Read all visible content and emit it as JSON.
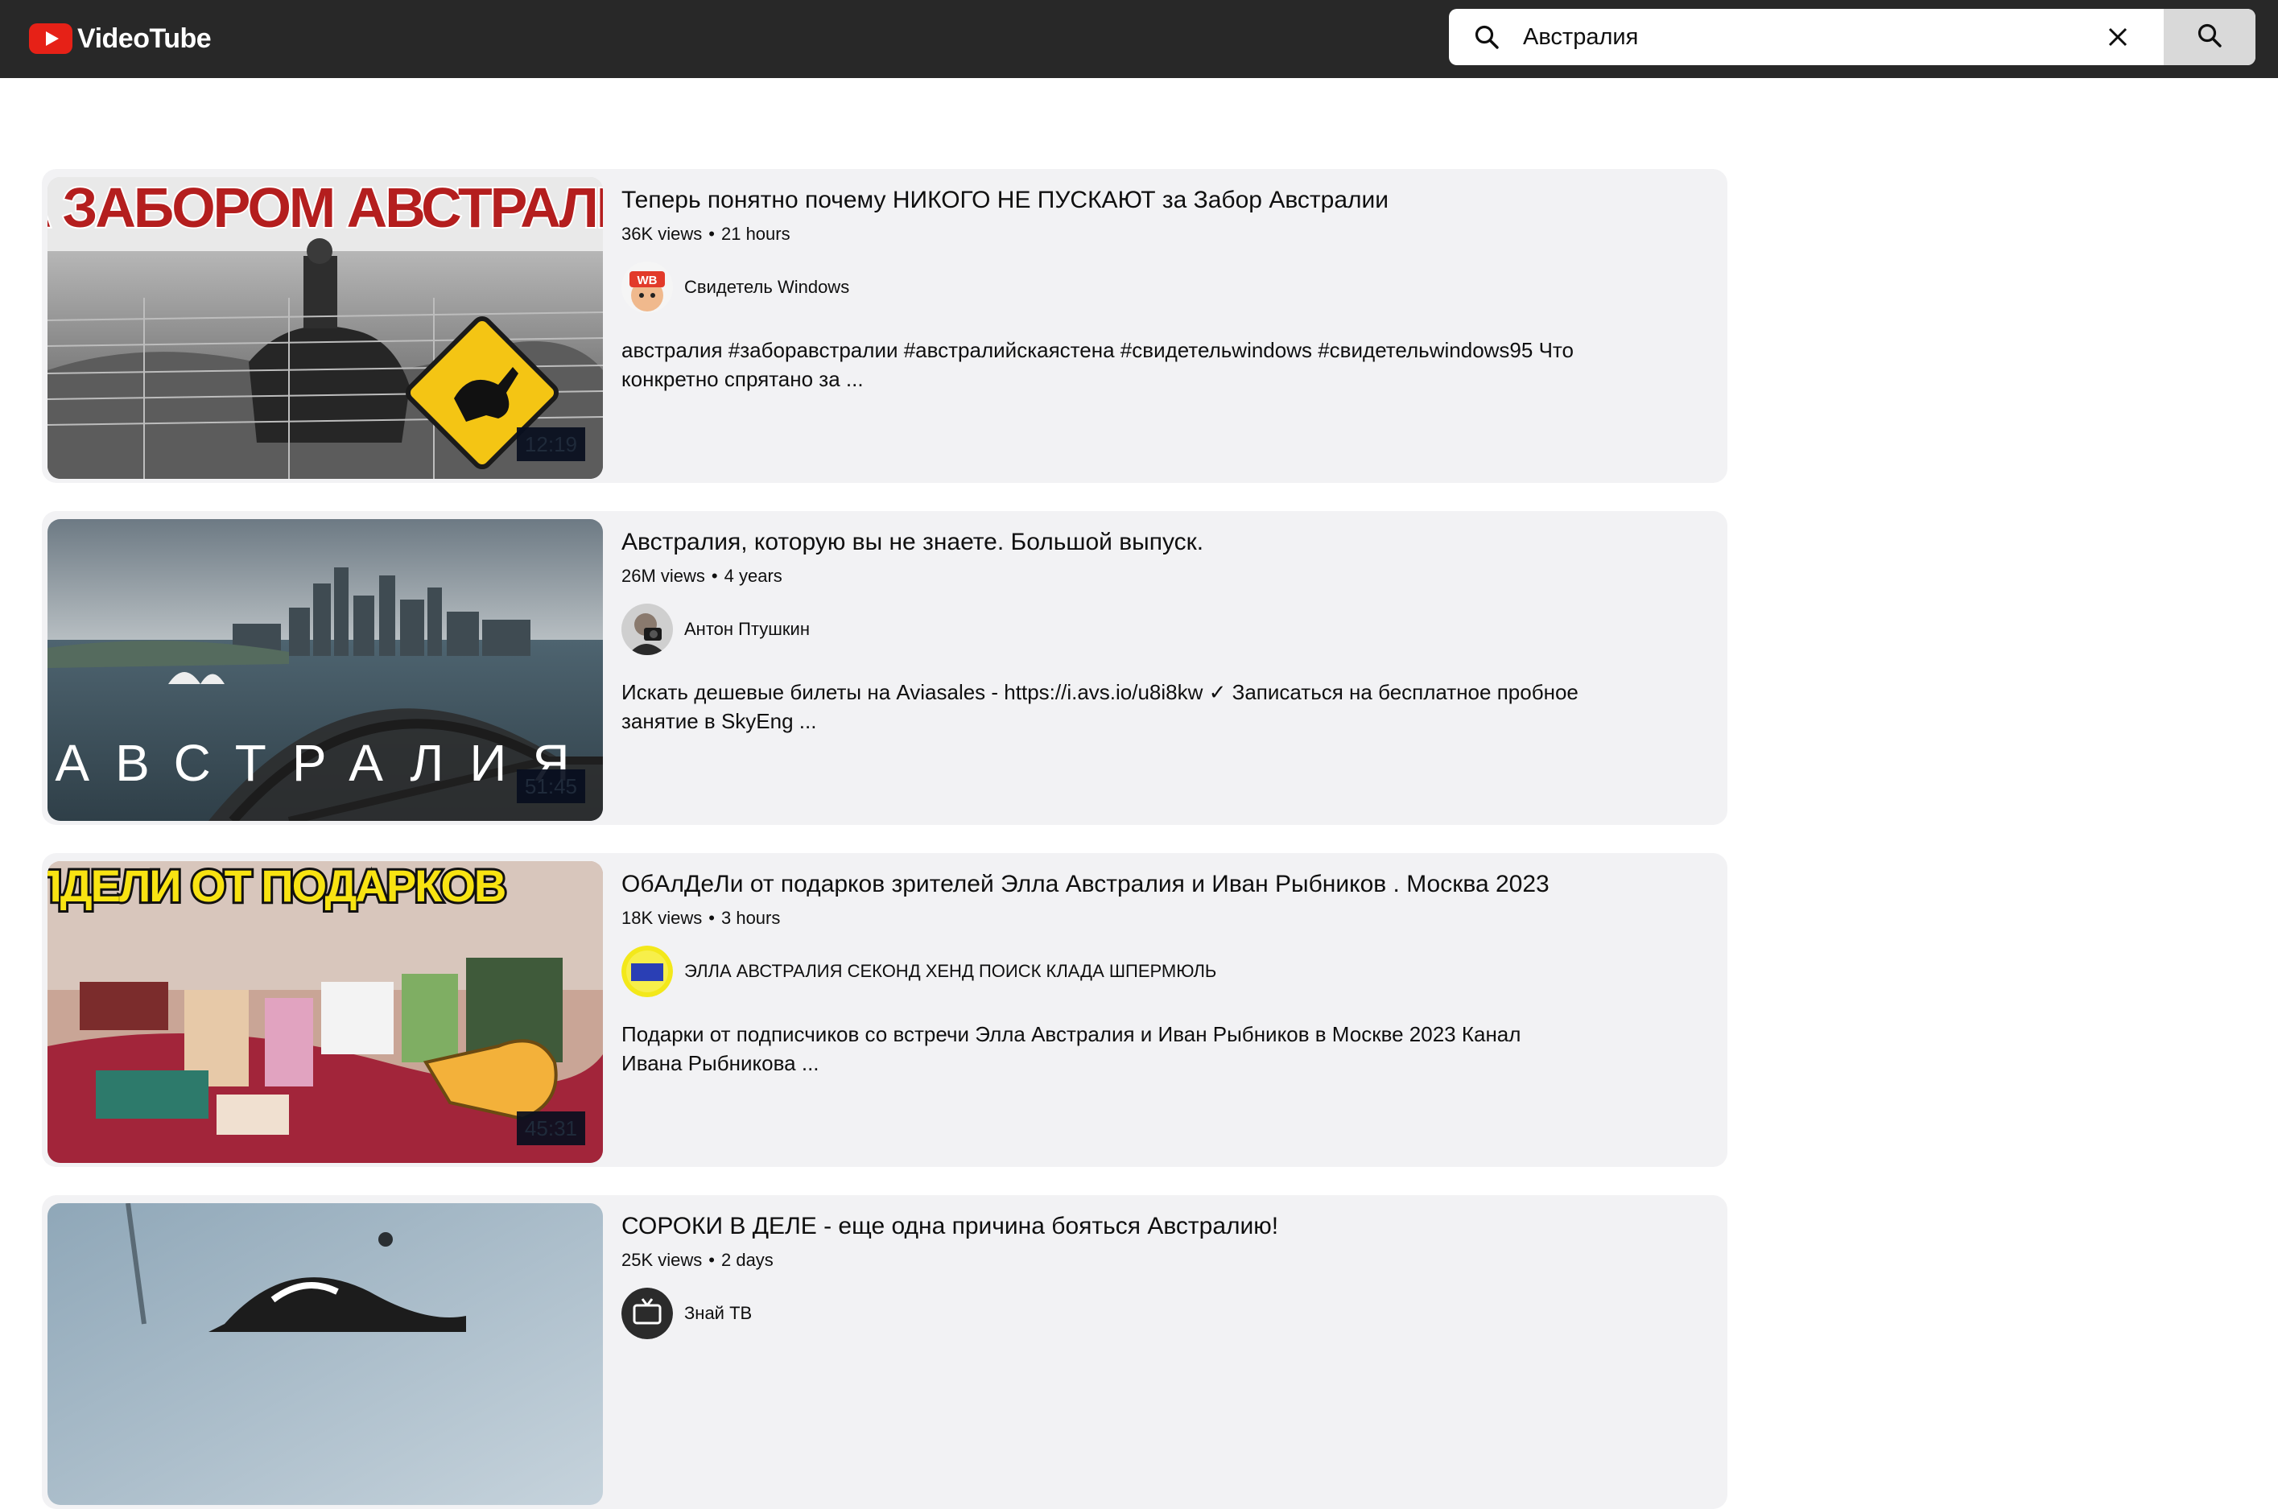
{
  "app": {
    "name": "VideoTube"
  },
  "search": {
    "query": "Австралия"
  },
  "results": [
    {
      "title": "Теперь понятно почему НИКОГО НЕ ПУСКАЮТ за Забор Австралии",
      "views": "36K views",
      "age": "21 hours",
      "channel": "Свидетель Windows",
      "description": "австралия #заборавстралии #австралийскаястена #свидетельwindows #свидетельwindows95 Что конкретно спрятано за ...",
      "duration": "12:19",
      "thumbnail_text": "ЗА ЗАБОРОМ АВСТРАЛИИ",
      "avatar_text": "WB"
    },
    {
      "title": "Австралия, которую вы не знаете. Большой выпуск.",
      "views": "26M views",
      "age": "4 years",
      "channel": "Антон Птушкин",
      "description": "Искать дешевые билеты на Aviasales - https://i.avs.io/u8i8kw ✓ Записаться на бесплатное пробное занятие в SkyEng ...",
      "duration": "51:45",
      "thumbnail_text": "АВСТРАЛИЯ"
    },
    {
      "title": "ОбАлДеЛи от подарков зрителей Элла Австралия и Иван Рыбников . Москва 2023",
      "views": "18K views",
      "age": "3 hours",
      "channel": "ЭЛЛА АВСТРАЛИЯ СЕКОНД ХЕНД ПОИСК КЛАДА ШПЕРМЮЛЬ",
      "description": "Подарки от подписчиков со встречи Элла Австралия и Иван Рыбников в Москве 2023 Канал Ивана Рыбникова ...",
      "duration": "45:31",
      "thumbnail_text": "ОБАЛДЕЛИ ОТ ПОДАРКОВ"
    },
    {
      "title": "СОРОКИ В ДЕЛЕ - еще одна причина бояться Австралию!",
      "views": "25K views",
      "age": "2 days",
      "channel": "Знай ТВ",
      "description": "",
      "duration": ""
    }
  ],
  "colors": {
    "topbar": "#282828",
    "card": "#f2f2f4",
    "logo_red": "#e62117"
  },
  "icons": {
    "logo": "play-logo-icon",
    "search_lens": "search-icon",
    "clear": "close-icon",
    "submit": "search-icon"
  }
}
